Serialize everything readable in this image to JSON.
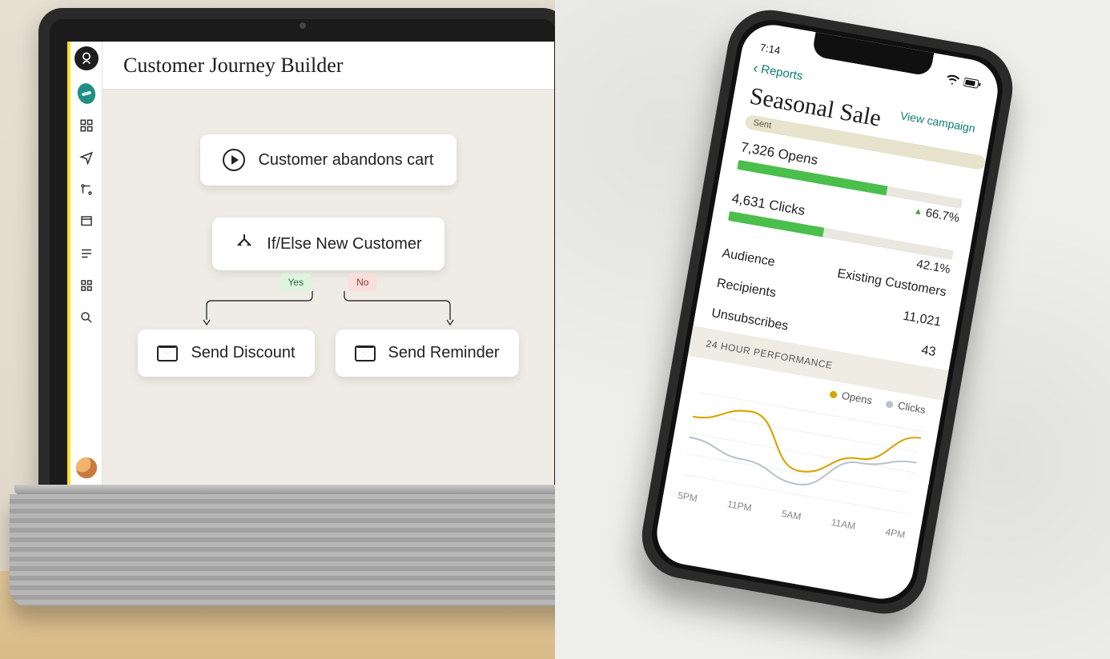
{
  "laptop": {
    "title": "Customer Journey Builder",
    "sidebar_icons": [
      "logo",
      "pencil",
      "content",
      "campaigns",
      "automations",
      "websites",
      "forms",
      "apps",
      "search"
    ],
    "trigger": {
      "label": "Customer abandons cart"
    },
    "condition": {
      "label": "If/Else New Customer",
      "yes": "Yes",
      "no": "No"
    },
    "actions": {
      "yes": "Send Discount",
      "no": "Send Reminder"
    }
  },
  "phone": {
    "status_time": "7:14",
    "back_label": "Reports",
    "title": "Seasonal Sale",
    "badge": "Sent",
    "view_campaign": "View campaign",
    "metrics": {
      "opens": {
        "label": "7,326 Opens",
        "fill_pct": 66.7,
        "pct_text": "66.7%",
        "trend": "up"
      },
      "clicks": {
        "label": "4,631 Clicks",
        "fill_pct": 42.1,
        "pct_text": "42.1%"
      }
    },
    "rows": [
      {
        "k": "Audience",
        "v": "Existing Customers"
      },
      {
        "k": "Recipients",
        "v": "11,021"
      },
      {
        "k": "Unsubscribes",
        "v": "43"
      }
    ],
    "section": "24 HOUR PERFORMANCE",
    "legend": {
      "opens": "Opens",
      "clicks": "Clicks"
    },
    "xaxis": [
      "5PM",
      "11PM",
      "5AM",
      "11AM",
      "4PM"
    ]
  },
  "chart_data": {
    "type": "line",
    "title": "24 HOUR PERFORMANCE",
    "xlabel": "",
    "ylabel": "",
    "categories": [
      "5PM",
      "11PM",
      "5AM",
      "11AM",
      "4PM"
    ],
    "series": [
      {
        "name": "Opens",
        "values": [
          70,
          88,
          28,
          55,
          92
        ]
      },
      {
        "name": "Clicks",
        "values": [
          45,
          30,
          12,
          50,
          62
        ]
      }
    ],
    "ylim": [
      0,
      100
    ]
  }
}
